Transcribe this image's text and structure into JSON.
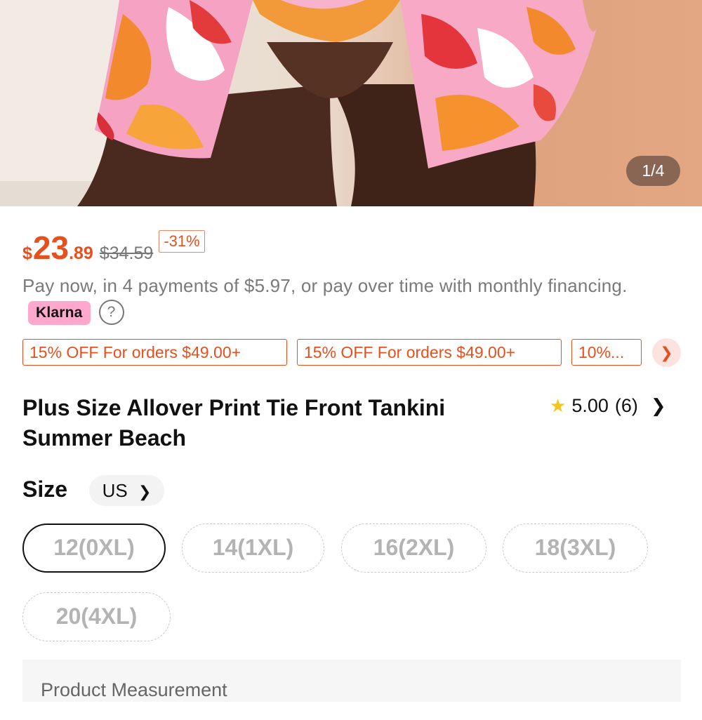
{
  "gallery": {
    "counter": "1/4"
  },
  "price": {
    "currency": "$",
    "integer": "23",
    "decimal": ".89",
    "original": "$34.59",
    "discount": "-31%"
  },
  "klarna": {
    "text": "Pay now, in 4 payments of $5.97, or pay over time with monthly financing.",
    "badge": "Klarna",
    "help": "?"
  },
  "coupons": [
    "15% OFF For orders $49.00+",
    "15% OFF For orders $49.00+",
    "10%..."
  ],
  "product": {
    "title": "Plus Size Allover Print Tie Front Tankini Summer Beach",
    "rating": "5.00",
    "review_count": "(6)"
  },
  "size": {
    "label": "Size",
    "region": "US",
    "options": [
      "12(0XL)",
      "14(1XL)",
      "16(2XL)",
      "18(3XL)",
      "20(4XL)"
    ],
    "selected": "12(0XL)"
  },
  "measurement": {
    "label": "Product Measurement"
  },
  "colors": {
    "accent": "#e4501e",
    "klarna": "#ffa8cd",
    "star": "#f5c518"
  }
}
